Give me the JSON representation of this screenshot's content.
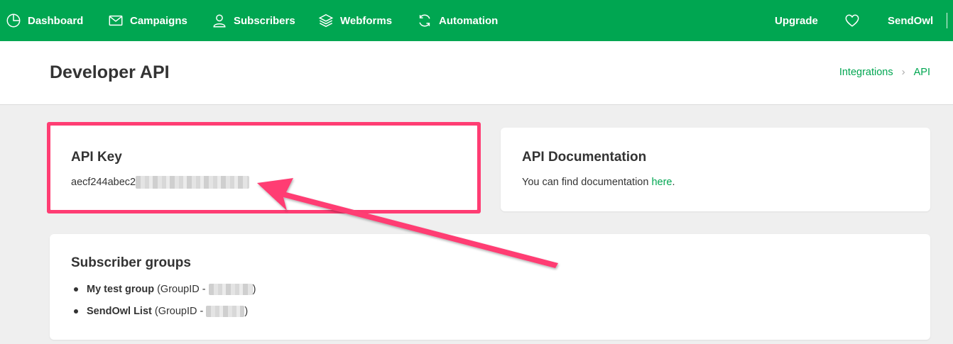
{
  "nav": {
    "items": [
      {
        "label": "Dashboard",
        "icon": "pie-chart-icon"
      },
      {
        "label": "Campaigns",
        "icon": "envelope-icon"
      },
      {
        "label": "Subscribers",
        "icon": "user-icon"
      },
      {
        "label": "Webforms",
        "icon": "layers-icon"
      },
      {
        "label": "Automation",
        "icon": "refresh-icon"
      }
    ],
    "upgrade": "Upgrade",
    "account": "SendOwl",
    "favorites_icon": "heart-icon"
  },
  "header": {
    "title": "Developer API",
    "breadcrumb": [
      "Integrations",
      "API"
    ]
  },
  "api_key_card": {
    "title": "API Key",
    "key_visible": "aecf244abec2"
  },
  "docs_card": {
    "title": "API Documentation",
    "text": "You can find documentation ",
    "link": "here",
    "text_end": "."
  },
  "groups_card": {
    "title": "Subscriber groups",
    "items": [
      {
        "name": "My test group",
        "suffix_open": " (GroupID - ",
        "suffix_close": ")"
      },
      {
        "name": "SendOwl List",
        "suffix_open": " (GroupID - ",
        "suffix_close": ")"
      }
    ]
  },
  "colors": {
    "brand_green": "#00a651",
    "highlight_pink": "#ff3d73",
    "background": "#efefef"
  }
}
